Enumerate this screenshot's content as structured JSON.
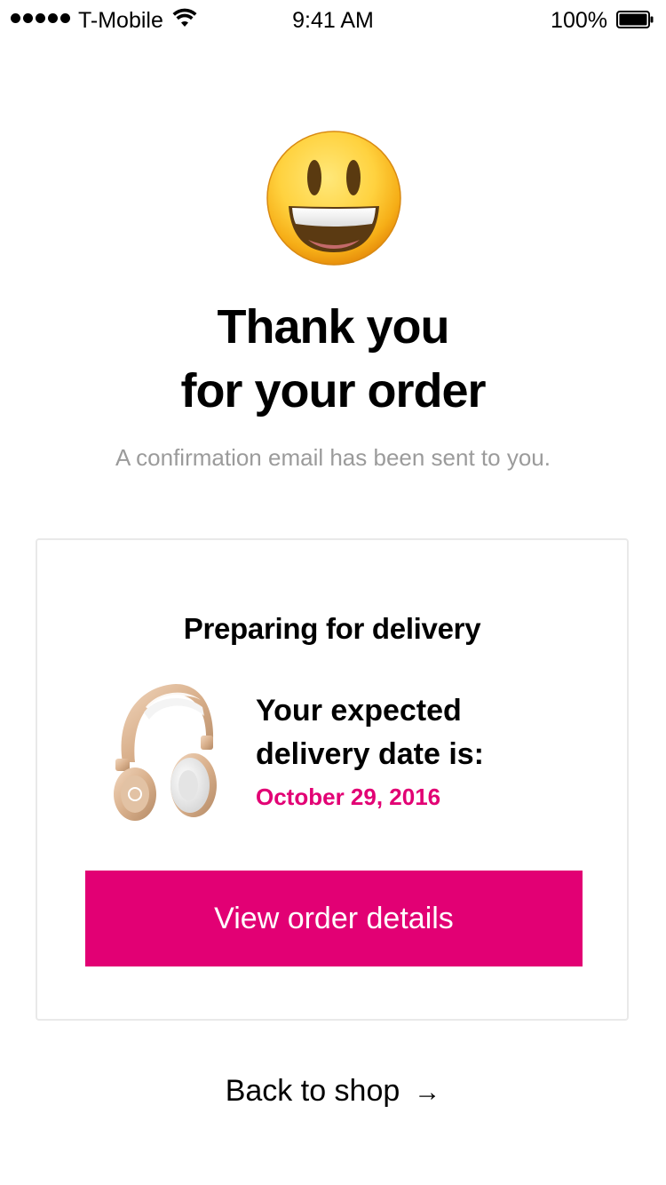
{
  "status_bar": {
    "carrier": "T-Mobile",
    "time": "9:41 AM",
    "battery_percent": "100%",
    "signal_bars": 5,
    "icons": [
      "signal-dots-icon",
      "wifi-icon",
      "battery-icon"
    ]
  },
  "header": {
    "emoji_icon": "smiling-face-icon",
    "title_line1": "Thank you",
    "title_line2": "for your order",
    "subtitle": "A confirmation email has been sent to you."
  },
  "card": {
    "title": "Preparing for delivery",
    "product_image": "headphones-icon",
    "delivery_label_line1": "Your expected",
    "delivery_label_line2": "delivery date is:",
    "delivery_date": "October 29, 2016",
    "button_label": "View order details"
  },
  "footer": {
    "back_label": "Back to shop",
    "back_icon": "arrow-right-icon"
  },
  "colors": {
    "accent": "#e20074",
    "subtitle_gray": "#9b9b9b",
    "card_border": "#e9e9e9"
  }
}
